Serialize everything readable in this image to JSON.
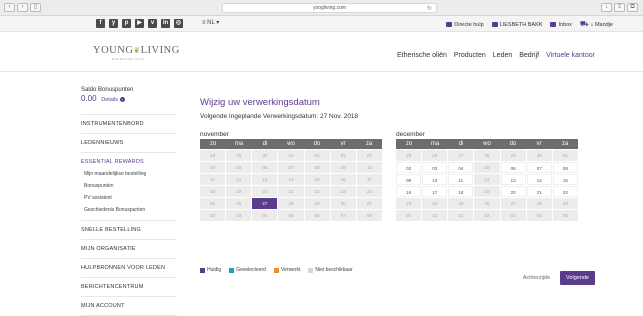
{
  "browser": {
    "url": "yoogliving.com"
  },
  "topbar": {
    "social_icons": [
      "facebook-icon",
      "youtube-icon",
      "pinterest-icon",
      "youtube-play-icon",
      "vimeo-icon",
      "linkedin-icon",
      "instagram-icon"
    ],
    "social_glyphs": [
      "f",
      "y",
      "p",
      "▶",
      "v",
      "in",
      "◎"
    ],
    "language": "≡ NL ▾",
    "links": {
      "help": "Directe hulp",
      "user": "LIESBETH BAKK",
      "inbox": "Inbox",
      "cart": "Mandje",
      "cart_count": "0"
    }
  },
  "header": {
    "logo_part1": "YOUNG",
    "logo_part2": "LIVING",
    "logo_sub": "ESSENTIAL OILS",
    "nav": [
      "Etherische oliën",
      "Producten",
      "Leden",
      "Bedrijf",
      "Virtuele kantoor"
    ]
  },
  "sidebar": {
    "saldo_label": "Saldo Bonuspunten",
    "saldo_value": "0.00",
    "saldo_details": "Details",
    "items": {
      "instrumentenbord": "INSTRUMENTENBORD",
      "ledennieuws": "LEDENNIEUWS",
      "essential_rewards": "ESSENTIAL REWARDS",
      "snelle_bestelling": "SNELLE BESTELLING",
      "organisatie": "MIJN ORGANISATIE",
      "hulpbronnen": "HULPBRONNEN VOOR LEDEN",
      "berichtencentrum": "BERICHTENCENTRUM",
      "account": "MIJN ACCOUNT"
    },
    "sub_items": {
      "maandelijkse": "Mijn maandelijkse bestelling",
      "bonuspunten": "Bonuspunten",
      "pv": "PV assistent",
      "geschiedenis": "Geschiedenis Bonuspunten"
    }
  },
  "main": {
    "title": "Wijzig uw verwerkingsdatum",
    "next_date": "Volgende Ingeplande Verwerkingsdatum: 27 Nov. 2018",
    "weekdays": [
      "zo",
      "ma",
      "di",
      "wo",
      "do",
      "vr",
      "za"
    ],
    "calendars": [
      {
        "month": "november",
        "days": [
          {
            "d": "28",
            "s": "u"
          },
          {
            "d": "29",
            "s": "u"
          },
          {
            "d": "30",
            "s": "u"
          },
          {
            "d": "31",
            "s": "u"
          },
          {
            "d": "01",
            "s": "u"
          },
          {
            "d": "02",
            "s": "u"
          },
          {
            "d": "03",
            "s": "u"
          },
          {
            "d": "04",
            "s": "u"
          },
          {
            "d": "05",
            "s": "u"
          },
          {
            "d": "06",
            "s": "u"
          },
          {
            "d": "07",
            "s": "u"
          },
          {
            "d": "08",
            "s": "u"
          },
          {
            "d": "09",
            "s": "u"
          },
          {
            "d": "10",
            "s": "u"
          },
          {
            "d": "11",
            "s": "u"
          },
          {
            "d": "12",
            "s": "u"
          },
          {
            "d": "13",
            "s": "u"
          },
          {
            "d": "14",
            "s": "u"
          },
          {
            "d": "15",
            "s": "u"
          },
          {
            "d": "16",
            "s": "u"
          },
          {
            "d": "17",
            "s": "u"
          },
          {
            "d": "18",
            "s": "u"
          },
          {
            "d": "19",
            "s": "u"
          },
          {
            "d": "20",
            "s": "u"
          },
          {
            "d": "21",
            "s": "u"
          },
          {
            "d": "22",
            "s": "u"
          },
          {
            "d": "23",
            "s": "u"
          },
          {
            "d": "24",
            "s": "u"
          },
          {
            "d": "25",
            "s": "u"
          },
          {
            "d": "26",
            "s": "u"
          },
          {
            "d": "27",
            "s": "c"
          },
          {
            "d": "28",
            "s": "u"
          },
          {
            "d": "29",
            "s": "u"
          },
          {
            "d": "30",
            "s": "u"
          },
          {
            "d": "01",
            "s": "u"
          },
          {
            "d": "02",
            "s": "u"
          },
          {
            "d": "03",
            "s": "u"
          },
          {
            "d": "04",
            "s": "u"
          },
          {
            "d": "05",
            "s": "u"
          },
          {
            "d": "06",
            "s": "u"
          },
          {
            "d": "07",
            "s": "u"
          },
          {
            "d": "08",
            "s": "u"
          }
        ]
      },
      {
        "month": "december",
        "days": [
          {
            "d": "25",
            "s": "u"
          },
          {
            "d": "26",
            "s": "u"
          },
          {
            "d": "27",
            "s": "u"
          },
          {
            "d": "28",
            "s": "u"
          },
          {
            "d": "29",
            "s": "u"
          },
          {
            "d": "30",
            "s": "u"
          },
          {
            "d": "01",
            "s": "u"
          },
          {
            "d": "02",
            "s": "a"
          },
          {
            "d": "03",
            "s": "a"
          },
          {
            "d": "04",
            "s": "a"
          },
          {
            "d": "05",
            "s": "u"
          },
          {
            "d": "06",
            "s": "a"
          },
          {
            "d": "07",
            "s": "a"
          },
          {
            "d": "08",
            "s": "a"
          },
          {
            "d": "09",
            "s": "a"
          },
          {
            "d": "10",
            "s": "a"
          },
          {
            "d": "11",
            "s": "a"
          },
          {
            "d": "12",
            "s": "u"
          },
          {
            "d": "13",
            "s": "a"
          },
          {
            "d": "14",
            "s": "a"
          },
          {
            "d": "15",
            "s": "a"
          },
          {
            "d": "16",
            "s": "a"
          },
          {
            "d": "17",
            "s": "a"
          },
          {
            "d": "18",
            "s": "a"
          },
          {
            "d": "19",
            "s": "u"
          },
          {
            "d": "20",
            "s": "a"
          },
          {
            "d": "21",
            "s": "a"
          },
          {
            "d": "22",
            "s": "a"
          },
          {
            "d": "23",
            "s": "u"
          },
          {
            "d": "24",
            "s": "u"
          },
          {
            "d": "25",
            "s": "u"
          },
          {
            "d": "26",
            "s": "u"
          },
          {
            "d": "27",
            "s": "u"
          },
          {
            "d": "28",
            "s": "u"
          },
          {
            "d": "29",
            "s": "u"
          },
          {
            "d": "30",
            "s": "u"
          },
          {
            "d": "31",
            "s": "u"
          },
          {
            "d": "01",
            "s": "u"
          },
          {
            "d": "02",
            "s": "u"
          },
          {
            "d": "03",
            "s": "u"
          },
          {
            "d": "04",
            "s": "u"
          },
          {
            "d": "05",
            "s": "u"
          }
        ]
      }
    ],
    "legend": [
      {
        "label": "Huidig",
        "color": "#5b3b8c"
      },
      {
        "label": "Geselecteerd",
        "color": "#1fa3b8"
      },
      {
        "label": "Verwerkt",
        "color": "#e8912b"
      },
      {
        "label": "Niet beschikbaar",
        "color": "#d4d4d4"
      }
    ],
    "back_label": "Achterzijde",
    "next_label": "Volgende"
  }
}
